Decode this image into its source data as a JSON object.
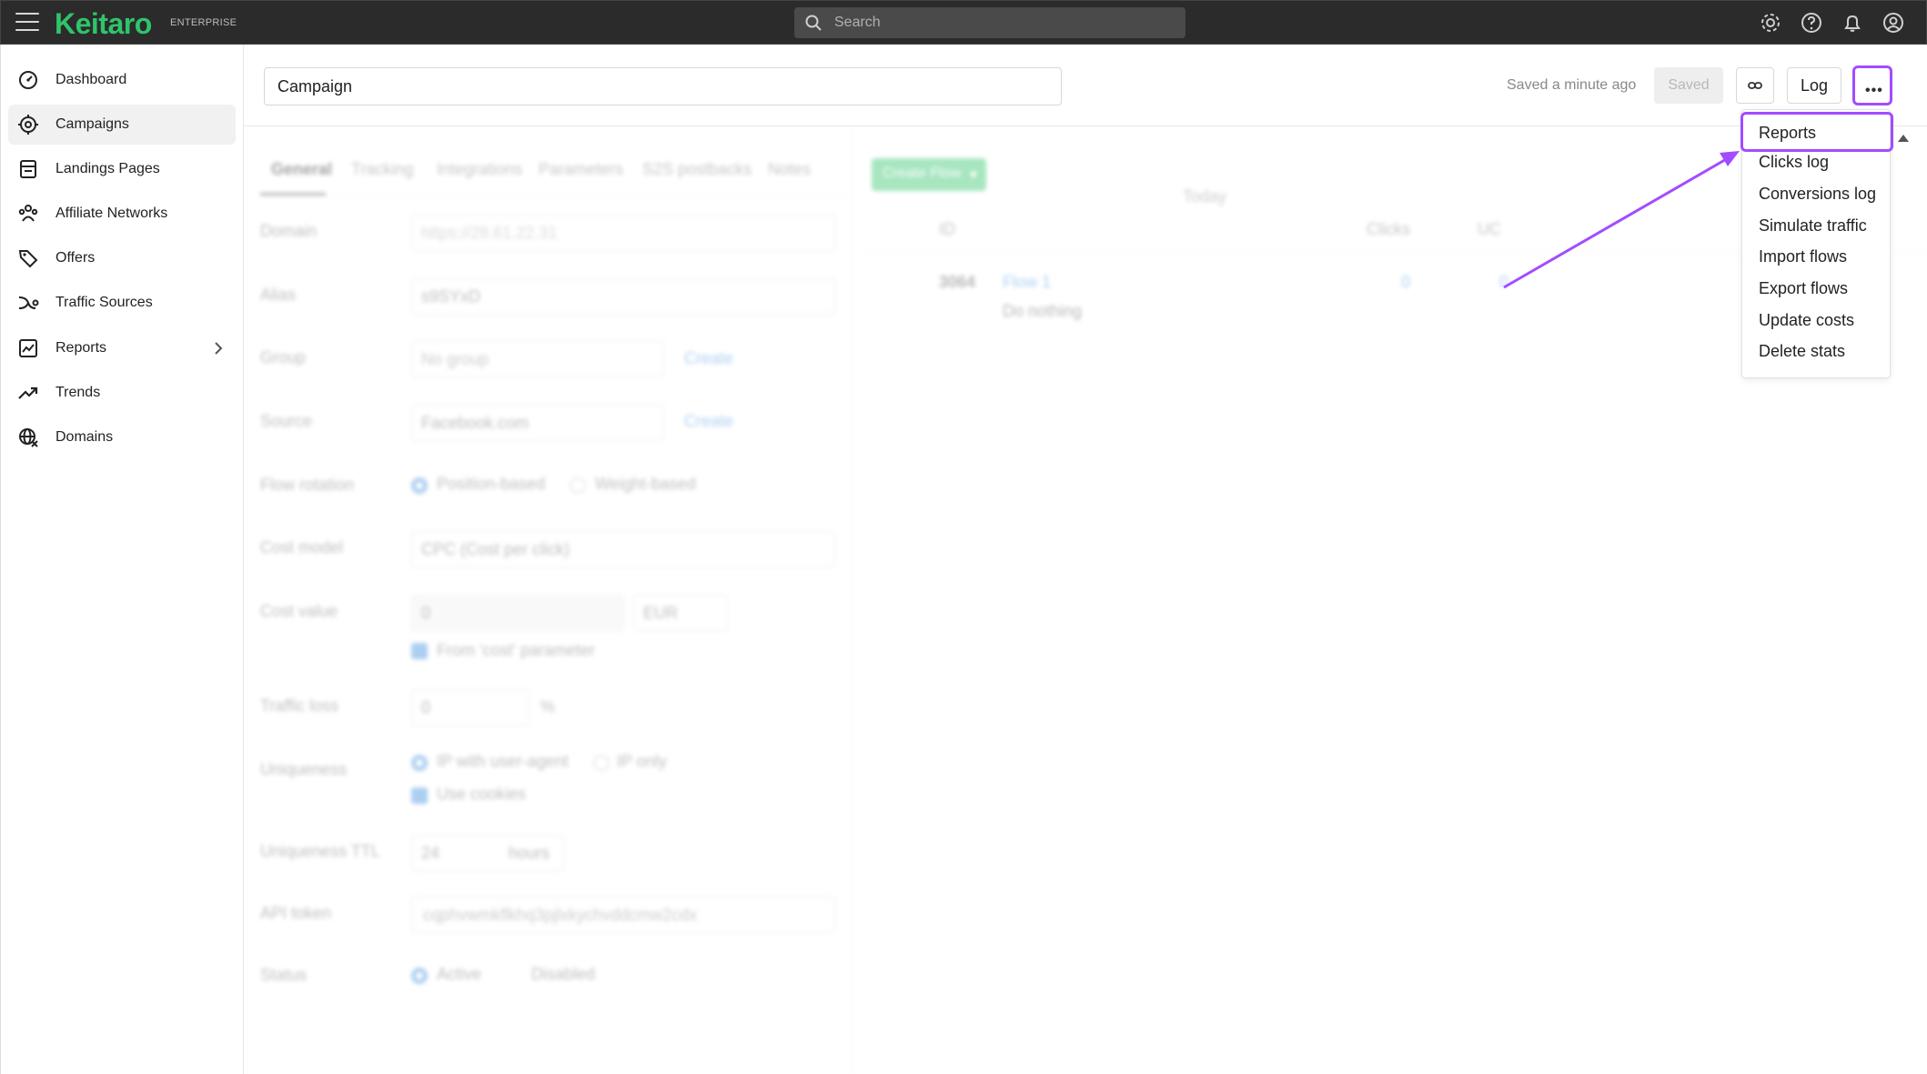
{
  "app": {
    "logo": "Keitaro",
    "edition": "ENTERPRISE"
  },
  "search": {
    "placeholder": "Search"
  },
  "sidebar": {
    "items": [
      {
        "label": "Dashboard",
        "icon": "dashboard-icon"
      },
      {
        "label": "Campaigns",
        "icon": "campaigns-icon",
        "active": true
      },
      {
        "label": "Landings Pages",
        "icon": "landing-pages-icon"
      },
      {
        "label": "Affiliate Networks",
        "icon": "affiliate-networks-icon"
      },
      {
        "label": "Offers",
        "icon": "offers-icon"
      },
      {
        "label": "Traffic Sources",
        "icon": "traffic-sources-icon"
      },
      {
        "label": "Reports",
        "icon": "reports-icon"
      },
      {
        "label": "Trends",
        "icon": "trends-icon"
      },
      {
        "label": "Domains",
        "icon": "domains-icon"
      }
    ]
  },
  "header": {
    "campaign_name": "Campaign",
    "saved_status": "Saved a minute ago",
    "saved_button": "Saved",
    "log_button": "Log"
  },
  "menu": {
    "items": [
      "Reports",
      "Clicks log",
      "Conversions log",
      "Simulate traffic",
      "Import flows",
      "Export flows",
      "Update costs",
      "Delete stats"
    ]
  },
  "form": {
    "tabs": [
      "General",
      "Tracking",
      "Integrations",
      "Parameters",
      "S2S postbacks",
      "Notes"
    ],
    "domain_label": "Domain",
    "domain_value": "https://28.61.22.31",
    "alias_label": "Alias",
    "alias_value": "s9SYxD",
    "group_label": "Group",
    "group_value": "No group",
    "create_link": "Create",
    "source_label": "Source",
    "source_value": "Facebook.com",
    "flow_rotation_label": "Flow rotation",
    "position_based": "Position-based",
    "weight_based": "Weight-based",
    "cost_model_label": "Cost model",
    "cost_model_value": "CPC (Cost per click)",
    "cost_value_label": "Cost value",
    "cost_value": "0",
    "currency": "EUR",
    "from_cost_param": "From 'cost' parameter",
    "traffic_loss_label": "Traffic loss",
    "traffic_loss_value": "0",
    "percent": "%",
    "uniqueness_label": "Uniqueness",
    "ip_with_ua": "IP with user-agent",
    "ip_only": "IP only",
    "use_cookies": "Use cookies",
    "uniqueness_ttl_label": "Uniqueness TTL",
    "ttl_value": "24",
    "hours": "hours",
    "api_token_label": "API token",
    "api_token_value": "cqphvwmkflkhq3pjlxkychvddcmw2cdx",
    "status_label": "Status",
    "active": "Active",
    "disabled": "Disabled"
  },
  "flows": {
    "create_button": "Create Flow",
    "col_id": "ID",
    "col_clicks": "Clicks",
    "col_uc": "UC",
    "period": "Today",
    "row_id": "3064",
    "row_name": "Flow 1",
    "row_action": "Do nothing",
    "row_clicks": "0",
    "row_uc": "0"
  },
  "colors": {
    "brand": "#2fc46a",
    "highlight": "#a24cff",
    "topbar": "#2b2b2b",
    "link": "#3a8dde"
  }
}
